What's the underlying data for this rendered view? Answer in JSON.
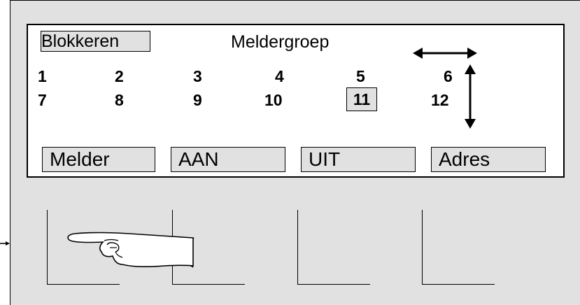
{
  "display": {
    "block_label": "Blokkeren",
    "title": "Meldergroep",
    "numbers": [
      "1",
      "2",
      "3",
      "4",
      "5",
      "6",
      "7",
      "8",
      "9",
      "10",
      "11",
      "12"
    ],
    "selected_number": "11"
  },
  "softkeys": [
    "Melder",
    "AAN",
    "UIT",
    "Adres"
  ],
  "icons": {
    "horizontal_arrow": "left-right-arrow-icon",
    "vertical_arrow": "up-down-arrow-icon",
    "hand": "pointing-hand-icon",
    "side_arrow": "right-arrow-icon"
  }
}
